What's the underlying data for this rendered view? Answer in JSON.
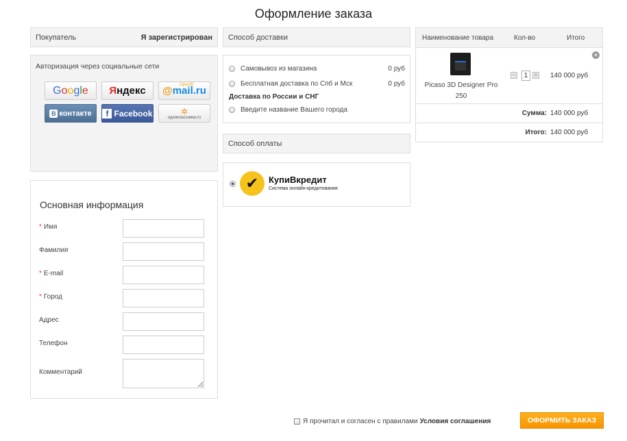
{
  "page": {
    "title": "Оформление заказа"
  },
  "buyer": {
    "label": "Покупатель",
    "registered_link": "Я зарегистрирован"
  },
  "social": {
    "title": "Авторизация через социальные сети",
    "providers": [
      {
        "name": "Google",
        "icon": "google-logo"
      },
      {
        "name": "Яндекс",
        "icon": "yandex-logo"
      },
      {
        "name": "OpenID mail.ru",
        "icon": "mailru-logo"
      },
      {
        "name": "ВКонтакте",
        "icon": "vk-logo"
      },
      {
        "name": "Facebook",
        "icon": "facebook-logo"
      },
      {
        "name": "одноклассники.ru",
        "icon": "odnoklassniki-logo"
      }
    ]
  },
  "info": {
    "title": "Основная информация",
    "fields": [
      {
        "label": "Имя",
        "required": true,
        "value": ""
      },
      {
        "label": "Фамилия",
        "required": false,
        "value": ""
      },
      {
        "label": "E-mail",
        "required": true,
        "value": ""
      },
      {
        "label": "Город",
        "required": true,
        "value": ""
      },
      {
        "label": "Адрес",
        "required": false,
        "value": ""
      },
      {
        "label": "Телефон",
        "required": false,
        "value": ""
      },
      {
        "label": "Комментарий",
        "required": false,
        "value": ""
      }
    ]
  },
  "delivery": {
    "title": "Способ доставки",
    "options": [
      {
        "label": "Самовывоз из магазина",
        "price": "0 руб",
        "selected": false
      },
      {
        "label": "Бесплатная доставка по Спб и Мск",
        "price": "0 руб",
        "selected": false
      }
    ],
    "group_label": "Доставка по России и СНГ",
    "city_option": {
      "label": "Введите название Вашего города",
      "selected": false
    }
  },
  "payment": {
    "title": "Способ оплаты",
    "option": {
      "name": "КупиВкредит",
      "subtitle": "Система онлайн-кредитования",
      "selected": true
    },
    "colors": {
      "logo_yellow": "#f6c21c"
    }
  },
  "cart": {
    "headers": {
      "name": "Наименование товара",
      "qty": "Кол-во",
      "total": "Итого"
    },
    "items": [
      {
        "name": "Picaso 3D Designer Pro 250",
        "qty": "1",
        "total": "140 000 руб",
        "icon": "3d-printer-image"
      }
    ],
    "summary": {
      "sum_label": "Сумма:",
      "sum_value": "140 000 руб",
      "total_label": "Итого:",
      "total_value": "140 000 руб"
    }
  },
  "footer": {
    "agree_text": "Я прочитал и согласен с правилами",
    "agree_link": "Условия соглашения",
    "agree_checked": false,
    "submit_label": "ОФОРМИТЬ ЗАКАЗ",
    "colors": {
      "submit_button": "#f79400"
    }
  }
}
